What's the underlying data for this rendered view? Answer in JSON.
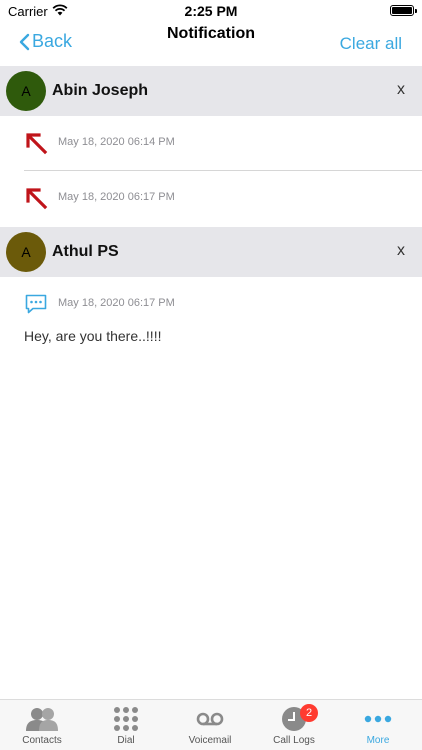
{
  "status_bar": {
    "carrier": "Carrier",
    "time": "2:25 PM"
  },
  "nav": {
    "back_label": "Back",
    "title": "Notification",
    "clear_all": "Clear all"
  },
  "groups": [
    {
      "avatar_initial": "A",
      "avatar_color": "#2f5a0c",
      "name": "Abin Joseph",
      "close": "x",
      "entries": [
        {
          "icon": "missed-call-icon",
          "timestamp": "May 18, 2020 06:14 PM"
        },
        {
          "icon": "missed-call-icon",
          "timestamp": "May 18, 2020 06:17 PM"
        }
      ]
    },
    {
      "avatar_initial": "A",
      "avatar_color": "#6b5a0a",
      "name": "Athul PS",
      "close": "x",
      "entries": [
        {
          "icon": "message-icon",
          "timestamp": "May 18, 2020 06:17 PM",
          "message": "Hey, are you there..!!!!"
        }
      ]
    }
  ],
  "tabbar": {
    "tabs": [
      {
        "label": "Contacts",
        "icon": "contacts-icon"
      },
      {
        "label": "Dial",
        "icon": "dialpad-icon"
      },
      {
        "label": "Voicemail",
        "icon": "voicemail-icon"
      },
      {
        "label": "Call Logs",
        "icon": "clock-icon",
        "badge": "2"
      },
      {
        "label": "More",
        "icon": "more-icon",
        "active": true
      }
    ]
  },
  "colors": {
    "accent": "#3aa8e0",
    "missed_call": "#c0141a",
    "badge": "#ff3b30"
  }
}
